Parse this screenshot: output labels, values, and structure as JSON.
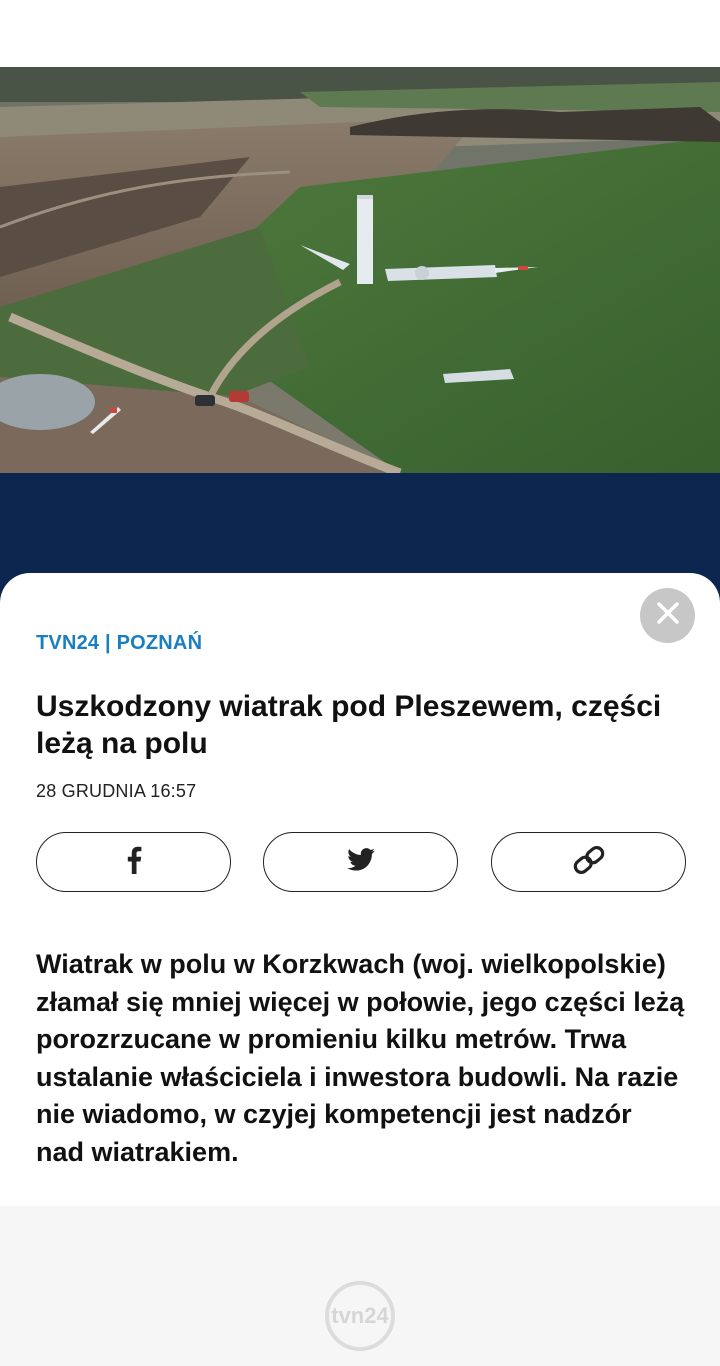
{
  "article": {
    "source": "TVN24",
    "separator": "|",
    "region": "POZNAŃ",
    "title": "Uszkodzony wiatrak pod Pleszewem, części leżą na polu",
    "date": "28 GRUDNIA 16:57",
    "lead": "Wiatrak w polu w Korzkwach (woj. wielkopolskie) złamał się mniej więcej w połowie, jego części leżą porozrzucane w promieniu kilku metrów. Trwa ustalanie właściciela i inwestora budowli. Na razie nie wiadomo, w czyjej kompetencji jest nadzór nad wiatrakiem."
  },
  "icons": {
    "close": "close-icon",
    "facebook": "facebook-icon",
    "twitter": "twitter-icon",
    "link": "link-icon",
    "footer_logo": "tvn24-logo"
  },
  "footer": {
    "logo_text": "tvn24"
  },
  "colors": {
    "accent": "#1a7ec1",
    "navy": "#0d2650",
    "close_bg": "#c7c7c7",
    "footer_bg": "#f6f6f6"
  }
}
